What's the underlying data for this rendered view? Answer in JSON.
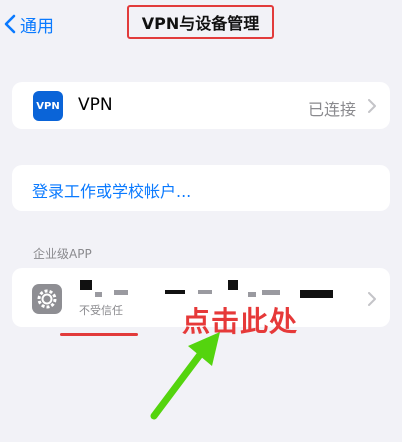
{
  "nav": {
    "back_label": "通用",
    "title": "VPN与设备管理"
  },
  "vpn": {
    "badge": "VPN",
    "label": "VPN",
    "status": "已连接"
  },
  "account": {
    "link": "登录工作或学校帐户..."
  },
  "enterprise": {
    "section": "企业级APP",
    "status": "不受信任"
  },
  "annotation": {
    "click_text": "点击此处"
  },
  "colors": {
    "accent": "#0a7aff",
    "annotation_red": "#e63939",
    "arrow_green": "#54d40e"
  }
}
